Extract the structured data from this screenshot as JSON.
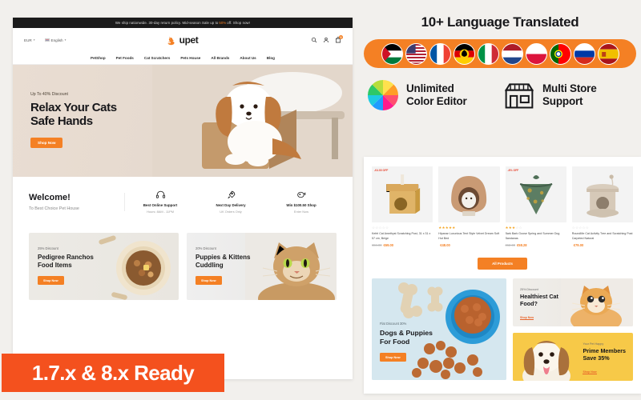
{
  "storefront": {
    "announcement": "We ship nationwide. 30-day return policy. Mid-season Sale up to",
    "announcement_highlight": "50%",
    "announcement_tail": "off. Shop now!",
    "currency": "EUR",
    "language": "English",
    "logo_text": "upet",
    "cart_count": "0",
    "nav": [
      {
        "label": "PetShop"
      },
      {
        "label": "Pet Foods"
      },
      {
        "label": "Cat Scratchers"
      },
      {
        "label": "Pets House"
      },
      {
        "label": "All Brands"
      },
      {
        "label": "About Us"
      },
      {
        "label": "Blog"
      }
    ],
    "hero": {
      "eyebrow": "Up To 40% Discount",
      "title_line1": "Relax Your Cats",
      "title_line2": "Safe Hands",
      "cta": "Shop Now"
    },
    "welcome": {
      "title": "Welcome!",
      "subtitle": "To Best Choice Pet House",
      "features": [
        {
          "icon": "headset-icon",
          "title": "Best Online Support",
          "sub": "Hours: 8AM - 11PM"
        },
        {
          "icon": "rocket-icon",
          "title": "Next Day Delivery",
          "sub": "UK Orders Only"
        },
        {
          "icon": "piggy-bank-icon",
          "title": "Win $100.50 Shop",
          "sub": "Enter Now"
        }
      ]
    },
    "promos": [
      {
        "eyebrow": "25% Discount",
        "title_line1": "Pedigree Ranchos",
        "title_line2": "Food Items",
        "cta": "Shop Now"
      },
      {
        "eyebrow": "20% Discount",
        "title_line1": "Puppies & Kittens",
        "title_line2": "Cuddling",
        "cta": "Shop Now"
      }
    ]
  },
  "ribbon": {
    "text": "1.7.x & 8.x Ready"
  },
  "languages": {
    "title": "10+ Language Translated",
    "flags": [
      {
        "name": "flag-palestine-icon"
      },
      {
        "name": "flag-usa-icon"
      },
      {
        "name": "flag-france-icon"
      },
      {
        "name": "flag-germany-icon"
      },
      {
        "name": "flag-italy-icon"
      },
      {
        "name": "flag-netherlands-icon"
      },
      {
        "name": "flag-poland-icon"
      },
      {
        "name": "flag-portugal-icon"
      },
      {
        "name": "flag-russia-icon"
      },
      {
        "name": "flag-spain-icon"
      }
    ]
  },
  "features": {
    "color_editor": {
      "icon": "color-wheel-icon",
      "line1": "Unlimited",
      "line2": "Color Editor"
    },
    "multi_store": {
      "icon": "store-icon",
      "line1": "Multi Store",
      "line2": "Support"
    }
  },
  "products": {
    "items": [
      {
        "discount": "-€4.00 OFF",
        "stars": 0,
        "name": "Kefel Cat Amethyst Scratching Post, 31 x 31 x 57 cm, Beige",
        "old_price": "€84.00",
        "price": "€69.00",
        "thumb": "cat-scratching-post"
      },
      {
        "discount": "",
        "stars": 5,
        "name": "Hipanar Luxurious Tent Style Velvet Dream Soft Hut Bed",
        "old_price": "",
        "price": "€48.00",
        "thumb": "cat-tent-bed"
      },
      {
        "discount": "-6% OFF",
        "stars": 3,
        "name": "Bark Bark Goose Spring and Summer Dog Bandanas",
        "old_price": "€62.00",
        "price": "€58.28",
        "thumb": "dog-bandana"
      },
      {
        "discount": "",
        "stars": 0,
        "name": "RoundMe Cat Activity Tree and Scratching Post Carpeted Natural",
        "old_price": "",
        "price": "€79.00",
        "thumb": "cat-activity-tree"
      }
    ],
    "all_products_label": "All Products"
  },
  "banners": {
    "main": {
      "eyebrow": "Flat Discount 30%",
      "title_line1": "Dogs & Puppies",
      "title_line2": "For Food",
      "cta": "Shop Now"
    },
    "cat": {
      "eyebrow": "25% Discount",
      "title_line1": "Healthiest Cat",
      "title_line2": "Food?",
      "cta": "Shop Now"
    },
    "dog": {
      "eyebrow": "Your Pet Happy",
      "title_line1": "Prime Members",
      "title_line2": "Save 35%",
      "cta": "Shop Now"
    }
  },
  "colors": {
    "accent": "#f48024",
    "ribbon": "#f4511e",
    "dark": "#1b1b1b",
    "yellow": "#f7c948"
  }
}
